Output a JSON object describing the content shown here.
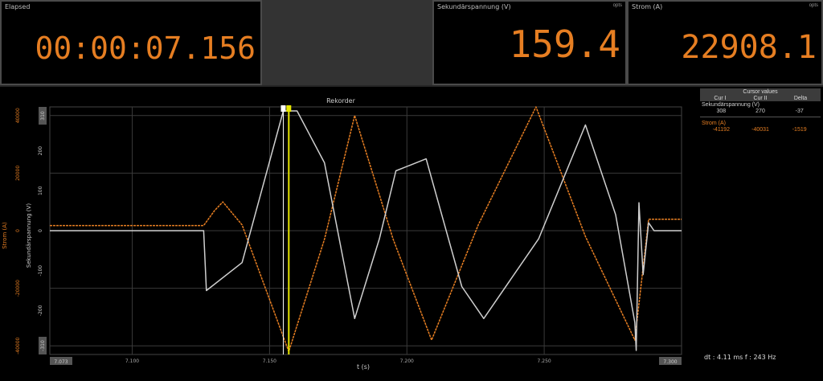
{
  "panels": {
    "elapsed": {
      "title": "Elapsed",
      "value": "00:00:07.156"
    },
    "voltage": {
      "title": "Sekundärspannung (V)",
      "value": "159.4",
      "opt": "opts"
    },
    "current": {
      "title": "Strom (A)",
      "value": "22908.1",
      "opt": "opts"
    }
  },
  "cursor_values": {
    "title": "Cursor values",
    "columns": [
      "Cur I",
      "Cur II",
      "Delta"
    ],
    "groups": [
      {
        "name": "Sekundärspannung (V)",
        "values": [
          "308",
          "270",
          "-37"
        ]
      },
      {
        "name": "Strom (A)",
        "values": [
          "-41192",
          "-40031",
          "-1519"
        ]
      }
    ]
  },
  "cursor_readout": "dt : 4.11 ms  f : 243 Hz",
  "chart_data": {
    "type": "line",
    "title": "Rekorder",
    "xlabel": "t (s)",
    "xlim": [
      7.07,
      7.3
    ],
    "x_ticks": [
      "7.100",
      "7.150",
      "7.200",
      "7.250"
    ],
    "x_range_labels": [
      "7.073",
      "7.300"
    ],
    "left_axis": {
      "label": "Strom (A)",
      "ticks": [
        "40000",
        "20000",
        "0",
        "-20000",
        "-40000"
      ],
      "ylim": [
        -43000,
        43000
      ]
    },
    "right_axis": {
      "label": "Sekundärspannung (V)",
      "ticks": [
        "200",
        "100",
        "0",
        "-100",
        "-200"
      ],
      "ylim": [
        -310,
        310
      ],
      "range_labels": [
        "310",
        "-310"
      ]
    },
    "cursors": [
      7.155,
      7.157
    ],
    "colors": {
      "current": "#e67e22",
      "voltage": "#cfcfcf",
      "cursor": "#e6e600"
    },
    "series": [
      {
        "name": "Strom (A)",
        "color": "#e67e22",
        "x": [
          7.07,
          7.125,
          7.126,
          7.13,
          7.133,
          7.14,
          7.157,
          7.17,
          7.181,
          7.195,
          7.209,
          7.226,
          7.247,
          7.265,
          7.283,
          7.288,
          7.3
        ],
        "y": [
          1800,
          1800,
          1800,
          7000,
          10000,
          2000,
          -42000,
          -3000,
          40000,
          -3000,
          -38000,
          2000,
          43000,
          -2000,
          -38000,
          4000,
          4000
        ]
      },
      {
        "name": "Sekundärspannung (V)",
        "color": "#cfcfcf",
        "x": [
          7.07,
          7.125,
          7.126,
          7.127,
          7.14,
          7.155,
          7.16,
          7.17,
          7.181,
          7.19,
          7.196,
          7.207,
          7.22,
          7.228,
          7.248,
          7.265,
          7.276,
          7.283,
          7.2835,
          7.2845,
          7.286,
          7.288,
          7.29,
          7.3
        ],
        "y": [
          0,
          0,
          0,
          -150,
          -80,
          300,
          300,
          170,
          -220,
          -20,
          150,
          180,
          -140,
          -220,
          -20,
          265,
          40,
          -230,
          -300,
          70,
          -110,
          20,
          0,
          0
        ]
      }
    ]
  }
}
